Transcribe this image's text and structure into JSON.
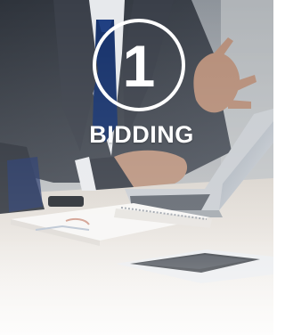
{
  "step": {
    "number": "1",
    "label": "BIDDING"
  },
  "photo": {
    "description_icon": "business-meeting-photo"
  },
  "colors": {
    "text": "#ffffff",
    "suit": "#3a3f4a",
    "tie": "#14306a",
    "table": "#e9e6e2"
  }
}
